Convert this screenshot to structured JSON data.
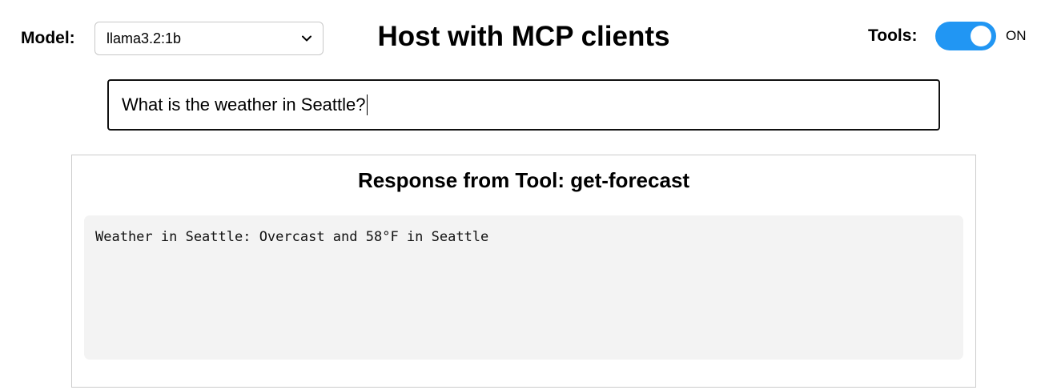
{
  "header": {
    "model_label": "Model:",
    "model_selected": "llama3.2:1b",
    "title": "Host with MCP clients",
    "tools_label": "Tools:",
    "tools_state": "ON"
  },
  "prompt": {
    "value": "What is the weather in Seattle?"
  },
  "response": {
    "title": "Response from Tool: get-forecast",
    "text": "Weather in Seattle: Overcast and 58°F in Seattle"
  },
  "colors": {
    "toggle_on": "#2196f3",
    "response_bg": "#f3f3f3"
  }
}
